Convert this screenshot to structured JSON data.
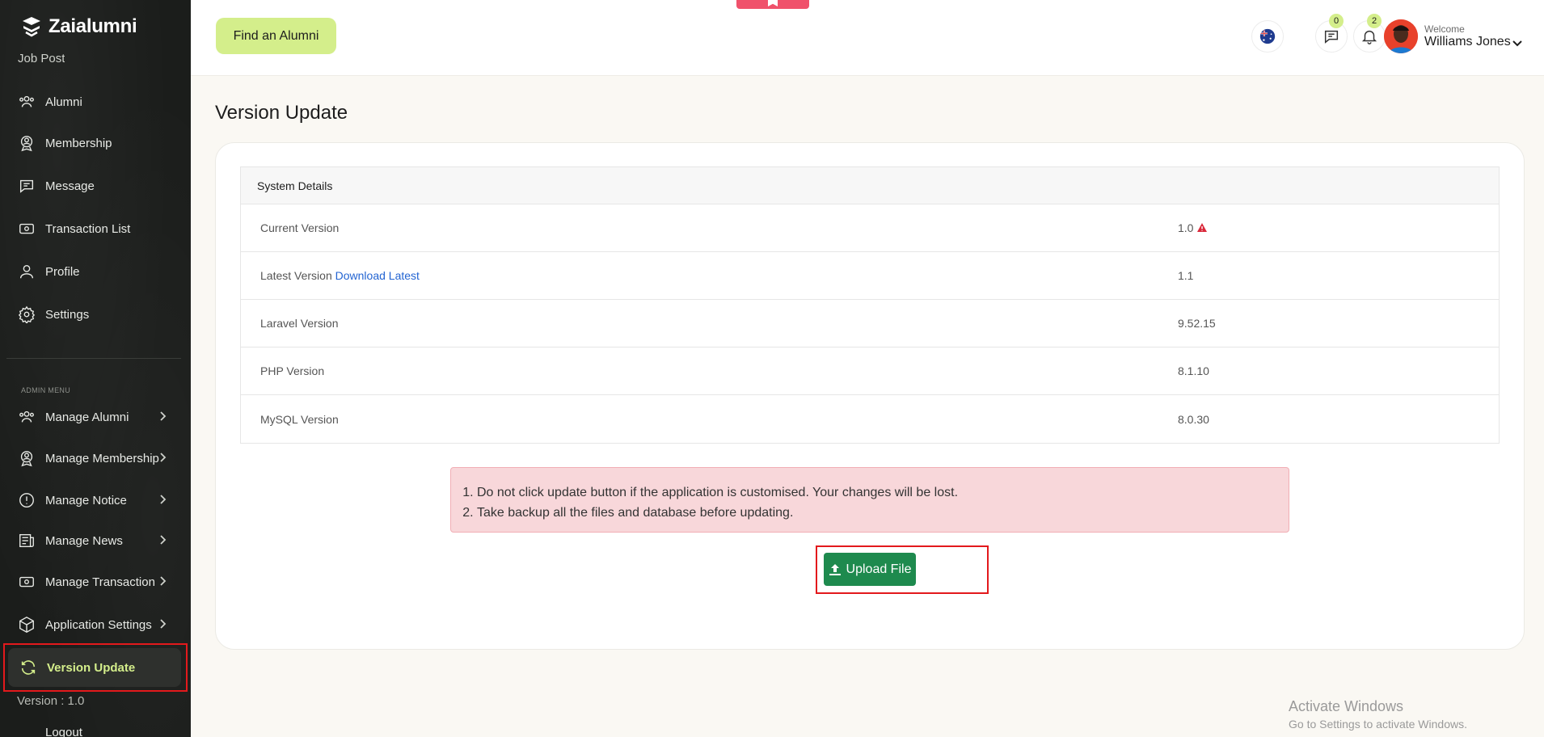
{
  "app": {
    "name": "Zaialumni"
  },
  "sidebar": {
    "cut_item": "Job Post",
    "items": [
      {
        "label": "Alumni",
        "icon": "users-icon"
      },
      {
        "label": "Membership",
        "icon": "badge-user-icon"
      },
      {
        "label": "Message",
        "icon": "message-icon"
      },
      {
        "label": "Transaction List",
        "icon": "cash-icon"
      },
      {
        "label": "Profile",
        "icon": "user-icon"
      },
      {
        "label": "Settings",
        "icon": "gear-icon"
      }
    ],
    "admin_label": "ADMIN MENU",
    "admin_items": [
      {
        "label": "Manage Alumni",
        "icon": "users-icon"
      },
      {
        "label": "Manage Membership",
        "icon": "badge-user-icon"
      },
      {
        "label": "Manage Notice",
        "icon": "alert-circle-icon"
      },
      {
        "label": "Manage News",
        "icon": "news-icon"
      },
      {
        "label": "Manage Transaction",
        "icon": "cash-icon"
      },
      {
        "label": "Application Settings",
        "icon": "hexagon-icon"
      }
    ],
    "active_item": {
      "label": "Version Update",
      "icon": "refresh-icon"
    },
    "version": "Version : 1.0",
    "logout": "Logout"
  },
  "topbar": {
    "find_button": "Find an Alumni",
    "chat_count": "0",
    "notification_count": "2",
    "welcome": "Welcome",
    "username": "Williams Jones"
  },
  "main": {
    "title": "Version Update",
    "table_header": "System Details",
    "rows": [
      {
        "key": "Current Version",
        "value": "1.0"
      },
      {
        "key": "Latest Version",
        "link": "Download Latest",
        "value": "1.1"
      },
      {
        "key": "Laravel Version",
        "value": "9.52.15"
      },
      {
        "key": "PHP Version",
        "value": "8.1.10"
      },
      {
        "key": "MySQL Version",
        "value": "8.0.30"
      }
    ],
    "alerts": [
      "Do not click update button if the application is customised. Your changes will be lost.",
      "Take backup all the files and database before updating."
    ],
    "upload_button": "Upload File"
  },
  "watermark": {
    "line1": "Activate Windows",
    "line2": "Go to Settings to activate Windows."
  },
  "colors": {
    "accent": "#d4ee8b",
    "sidebar_bg": "#1b1d1b",
    "success": "#1e8a4e",
    "danger_outline": "#e3191c",
    "alert_bg": "#f8d7da"
  }
}
